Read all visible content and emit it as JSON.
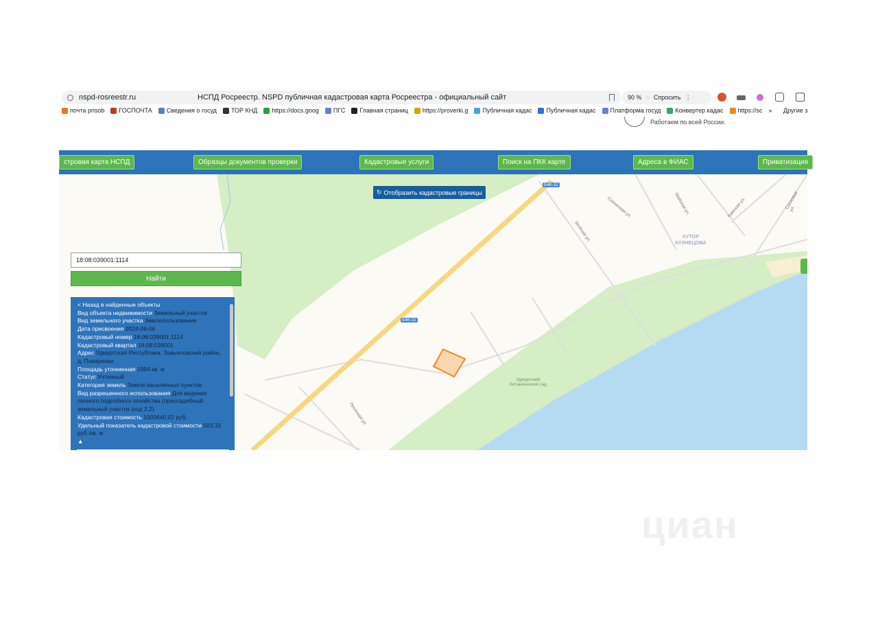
{
  "browser": {
    "url": "nspd-rosreestr.ru",
    "title": "НСПД Росреестр. NSPD публичная кадастровая карта Росреестра - официальный сайт",
    "zoom": "90 %",
    "ask_label": "Спросить",
    "bookmarks": [
      "почта prisob",
      "ГОСПОЧТА",
      "Сведения о госуд",
      "ТОР КНД",
      "https://docs.goog",
      "ПГС",
      "Главная страниц",
      "https://proverki.g",
      "Публичная кадас",
      "Публичная кадас",
      "Платформа госуд",
      "Конвертер кадас",
      "https://sc"
    ],
    "bookmark_colors": [
      "#e8762c",
      "#c0392b",
      "#5b7fc4",
      "#333333",
      "#2e9e44",
      "#6a7fd0",
      "#222222",
      "#d9a400",
      "#4aa3df",
      "#2f6fd0",
      "#6a7fd0",
      "#3aa36a",
      "#f08a1c"
    ],
    "more": "»",
    "other": "Другие з"
  },
  "site": {
    "tagline": "Работаем по всей России."
  },
  "nav": [
    "стровая карта НСПД",
    "Образцы документов проверки",
    "Кадастровые услуги",
    "Поиск на ПКК карте",
    "Адреса в ФИАС",
    "Приватизация"
  ],
  "map": {
    "bounds_button": "Отобразить кадастровые границы",
    "search_value": "18:08:039001:1114",
    "find_label": "Найти",
    "road_badge": "Б4К-11",
    "village": "ХУТОР КУЗНЕЦОВА",
    "garden": "Удмуртский ботанический сад",
    "streets": [
      "Солнечная ул.",
      "Майская ул.",
      "Камская ул.",
      "Сосновая ул.",
      "Зелёная ул.",
      "Песочная ул."
    ],
    "colors": {
      "land": "#fbfaf4",
      "forest": "#d5eec4",
      "water": "#b5dbf3",
      "road": "#f7d77f",
      "parcel": "#f08a24"
    }
  },
  "info": {
    "back": "< Назад в найденные объекты",
    "rows": [
      {
        "label": "Вид объекта недвижимости",
        "value": "Земельный участок"
      },
      {
        "label": "Вид земельного участка",
        "value": "Землепользование"
      },
      {
        "label": "Дата присвоения",
        "value": "2024-08-06"
      },
      {
        "label": "Кадастровый номер",
        "value": "18:08:039001:1114"
      },
      {
        "label": "Кадастровый квартал",
        "value": "18:08:039001"
      },
      {
        "label": "Адрес",
        "value": "Удмуртская Республика, Завьяловский район, д. Поваренки"
      },
      {
        "label": "Площадь уточненная",
        "value": "1994 кв. м"
      },
      {
        "label": "Статус",
        "value": "Учтенный"
      },
      {
        "label": "Категория земель",
        "value": "Земли населенных пунктов"
      },
      {
        "label": "Вид разрешенного использования",
        "value": "Для ведения личного подсобного хозяйства (приусадебный земельный участок (код 2.2)"
      },
      {
        "label": "Кадастровая стоимость",
        "value": "1003640.02 руб."
      },
      {
        "label": "Удельный показатель кадастровой стоимости",
        "value": "503.33 руб./кв. м"
      }
    ],
    "triangle": "▲"
  },
  "watermark": "циан"
}
